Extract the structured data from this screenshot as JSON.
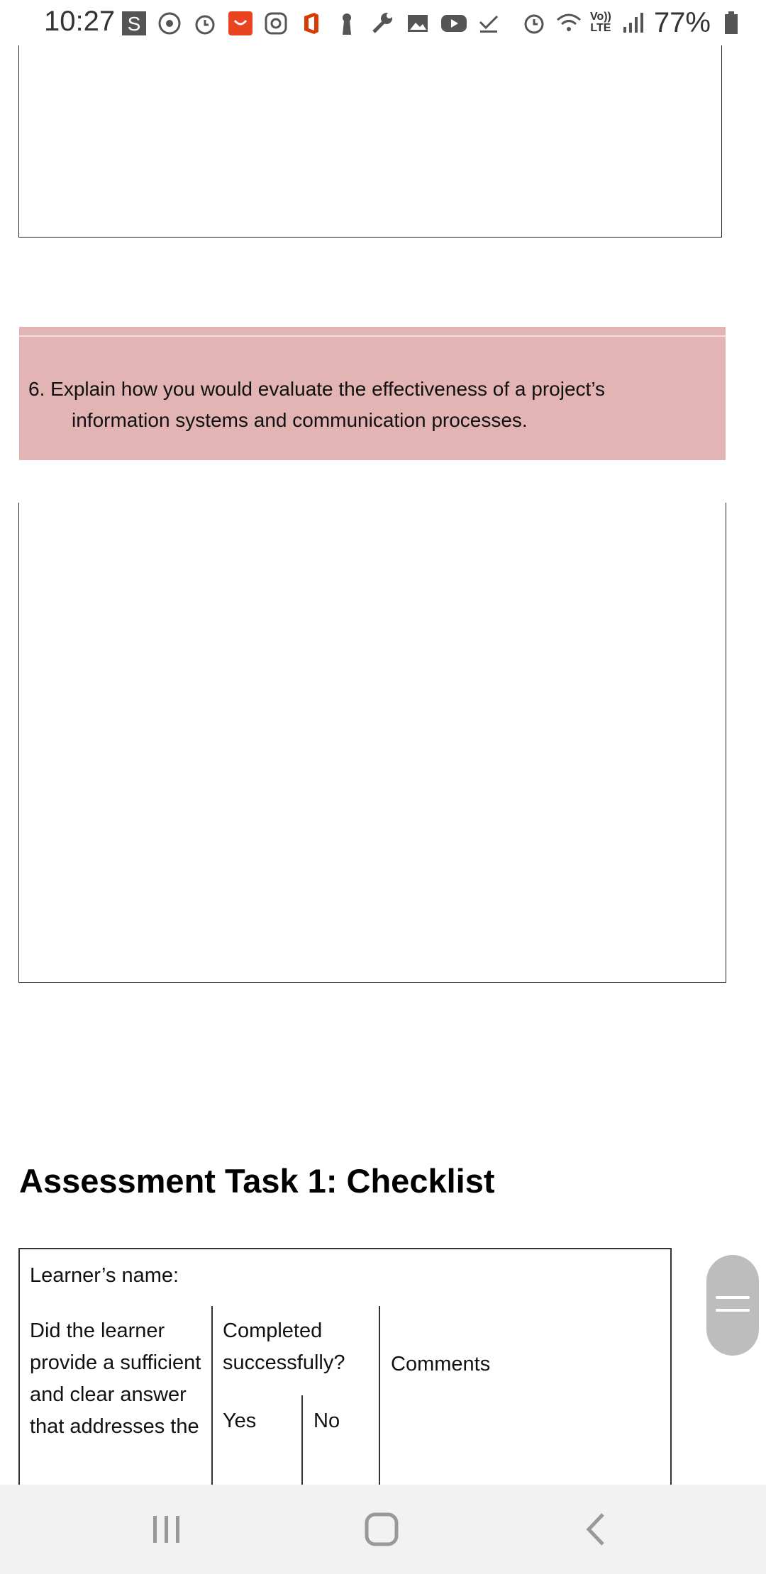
{
  "status_bar": {
    "time": "10:27",
    "battery": "77%",
    "network": "Vo)) LTE",
    "left_icons": [
      "s-icon",
      "sync-icon",
      "alarm-icon",
      "aliexpress-icon",
      "instagram-icon",
      "office-icon",
      "keyhole-icon",
      "wrench-icon",
      "gallery-icon",
      "youtube-icon",
      "check-icon"
    ],
    "right_icons": [
      "alarm-icon",
      "wifi-icon",
      "lte-icon",
      "signal-icon",
      "battery-icon"
    ]
  },
  "document": {
    "question": {
      "number": "6.",
      "line1": "Explain how you would evaluate the effectiveness of a project’s",
      "line2": "information systems and communication processes."
    },
    "heading": "Assessment Task 1: Checklist",
    "table": {
      "learner_label": "Learner’s name:",
      "criteria_header": "Did the learner provide a sufficient and clear answer that addresses the",
      "completed_header": "Completed successfully?",
      "comments_header": "Comments",
      "yes": "Yes",
      "no": "No"
    }
  },
  "colors": {
    "question_band": "#e3b4b4",
    "nav_bar": "#f2f2f2",
    "scroll_handle": "#bdbdbd"
  },
  "nav": {
    "icons": [
      "recent-apps-icon",
      "home-icon",
      "back-icon"
    ]
  }
}
